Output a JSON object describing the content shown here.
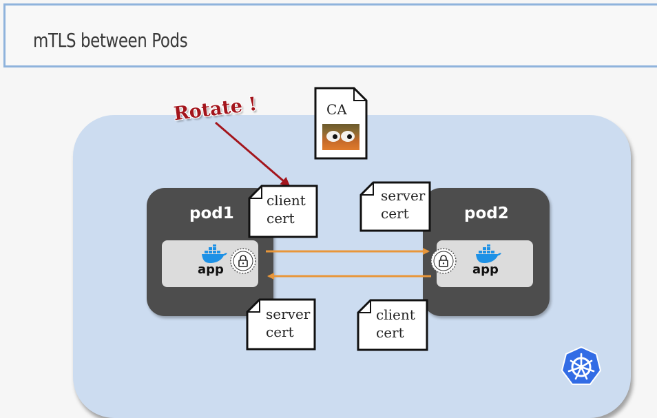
{
  "slide": {
    "title": "mTLS between Pods"
  },
  "annotation": {
    "rotate_label": "Rotate !"
  },
  "ca": {
    "label": "CA"
  },
  "pods": [
    {
      "label": "pod1",
      "app_label": "app"
    },
    {
      "label": "pod2",
      "app_label": "app"
    }
  ],
  "certs": {
    "pod1_client": {
      "line1": "client",
      "line2": "cert"
    },
    "pod1_server": {
      "line1": "server",
      "line2": "cert"
    },
    "pod2_server": {
      "line1": "server",
      "line2": "cert"
    },
    "pod2_client": {
      "line1": "client",
      "line2": "cert"
    }
  },
  "colors": {
    "cluster_bg": "#ccdcf0",
    "pod_bg": "#4d4d4d",
    "arrow_orange": "#e8963a",
    "rotate_red": "#a3151c",
    "k8s_blue": "#326ce5",
    "docker_blue": "#1d91e6"
  },
  "icons": [
    "docker-icon",
    "lock-icon",
    "kubernetes-icon",
    "document-icon"
  ]
}
